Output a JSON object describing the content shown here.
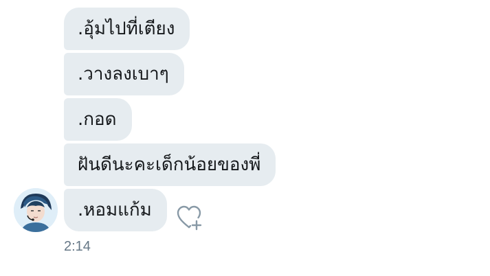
{
  "messages": [
    {
      "text": ".อุ้มไปที่เตียง"
    },
    {
      "text": ".วางลงเบาๆ"
    },
    {
      "text": ".กอด"
    },
    {
      "text": "ฝันดีนะคะเด็กน้อยของพี่"
    },
    {
      "text": ".หอมแก้ม"
    }
  ],
  "timestamp": "2:14",
  "icons": {
    "like": "heart-plus-icon",
    "avatar": "user-avatar"
  },
  "colors": {
    "bubble": "#e6ecf0",
    "text": "#14171a",
    "muted": "#657786"
  }
}
